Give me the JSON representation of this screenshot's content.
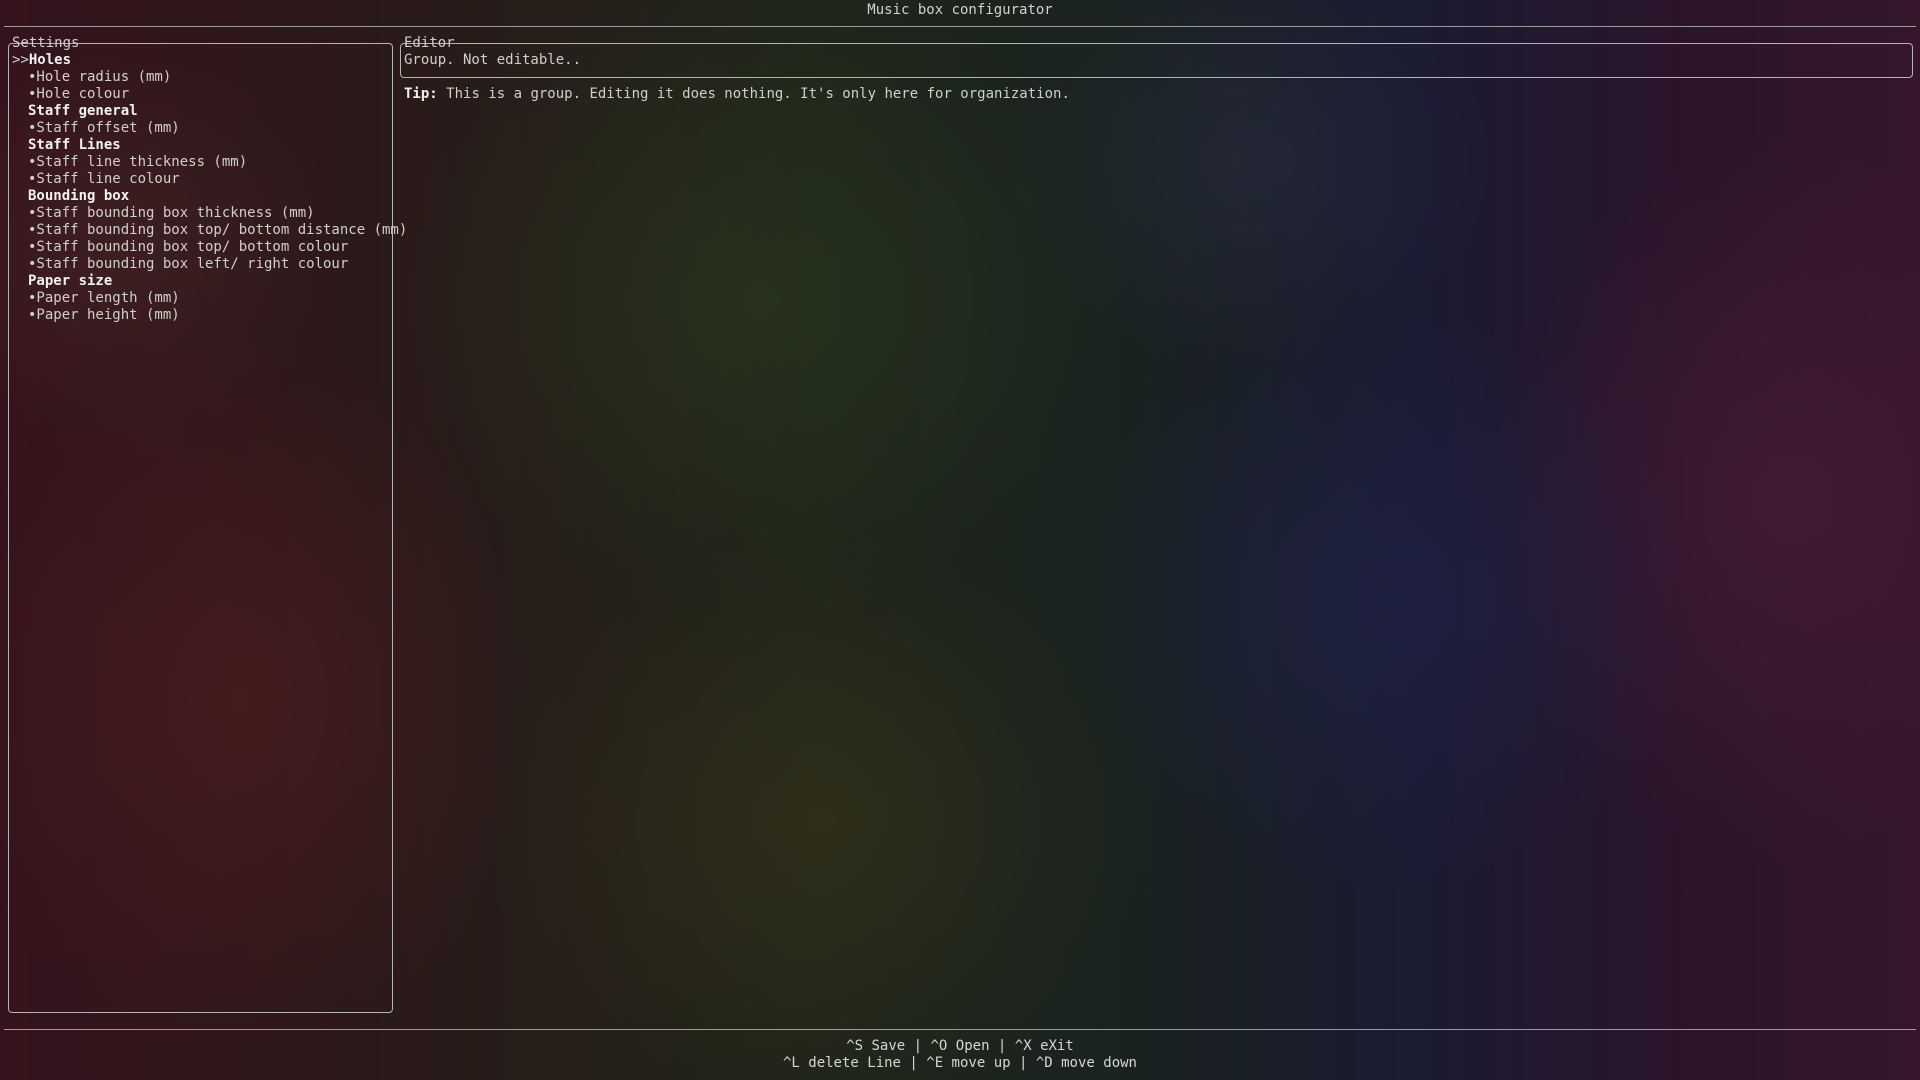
{
  "app": {
    "title": "Music box configurator"
  },
  "settings": {
    "panel_title": "Settings",
    "caret": ">>",
    "groups": [
      {
        "label": "Holes",
        "items": [
          "•Hole radius (mm)",
          "•Hole colour"
        ]
      },
      {
        "label": "Staff general",
        "items": [
          "•Staff offset (mm)"
        ]
      },
      {
        "label": "Staff Lines",
        "items": [
          "•Staff line thickness (mm)",
          "•Staff line colour"
        ]
      },
      {
        "label": "Bounding box",
        "items": [
          "•Staff bounding box thickness (mm)",
          "•Staff bounding box top/ bottom distance (mm)",
          "•Staff bounding box top/ bottom colour",
          "•Staff bounding box left/ right colour"
        ]
      },
      {
        "label": "Paper size",
        "items": [
          "•Paper length (mm)",
          "•Paper height (mm)"
        ]
      }
    ]
  },
  "editor": {
    "panel_title": "Editor",
    "value": "Group. Not editable.."
  },
  "tip": {
    "label": "Tip:",
    "text": "This is a group. Editing it does nothing. It's only here for organization."
  },
  "shortcuts": {
    "line1": "^S Save | ^O Open | ^X eXit",
    "line2": "^L delete Line | ^E move up | ^D move down"
  }
}
